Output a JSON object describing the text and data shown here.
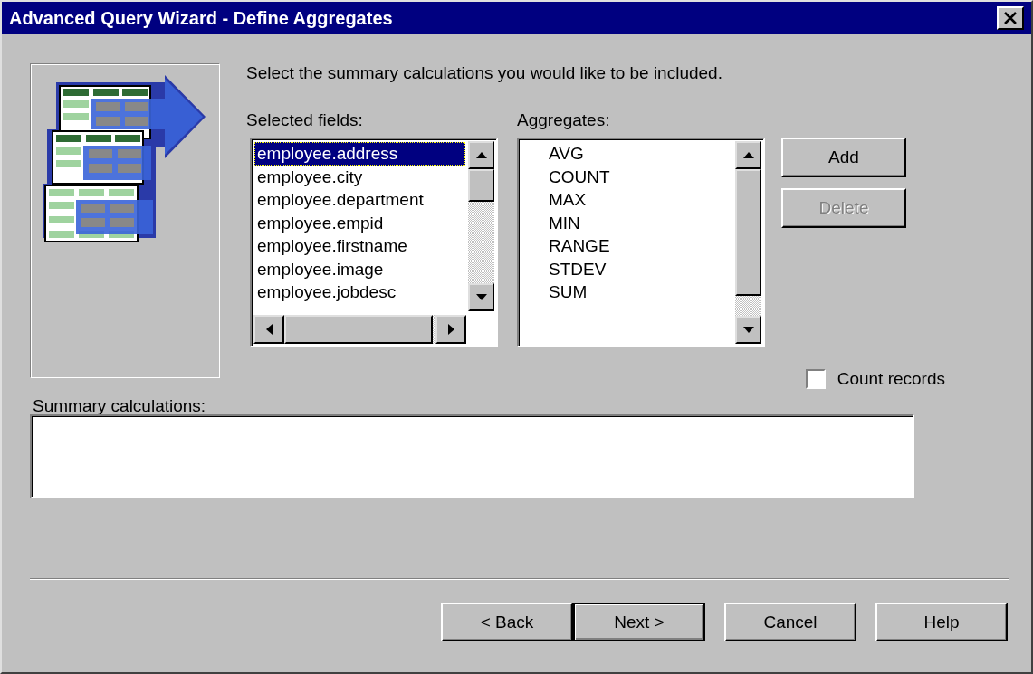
{
  "window": {
    "title": "Advanced Query Wizard - Define Aggregates"
  },
  "instruction": "Select the summary calculations you would like to be included.",
  "selected_fields": {
    "label": "Selected fields:",
    "items": [
      {
        "text": "employee.address",
        "selected": true
      },
      {
        "text": "employee.city",
        "selected": false
      },
      {
        "text": "employee.department",
        "selected": false
      },
      {
        "text": "employee.empid",
        "selected": false
      },
      {
        "text": "employee.firstname",
        "selected": false
      },
      {
        "text": "employee.image",
        "selected": false
      },
      {
        "text": "employee.jobdesc",
        "selected": false
      }
    ]
  },
  "aggregates": {
    "label": "Aggregates:",
    "items": [
      {
        "text": "AVG",
        "selected": false
      },
      {
        "text": "COUNT",
        "selected": false
      },
      {
        "text": "MAX",
        "selected": false
      },
      {
        "text": "MIN",
        "selected": false
      },
      {
        "text": "RANGE",
        "selected": false
      },
      {
        "text": "STDEV",
        "selected": false
      },
      {
        "text": "SUM",
        "selected": false
      }
    ]
  },
  "side_buttons": [
    {
      "label": "Add",
      "disabled": false
    },
    {
      "label": "Delete",
      "disabled": true
    }
  ],
  "count_records": {
    "label": "Count records",
    "checked": false
  },
  "summary": {
    "label": "Summary calculations:"
  },
  "buttons": [
    {
      "label": "< Back",
      "default": false
    },
    {
      "label": "Next >",
      "default": true
    },
    {
      "label": "Cancel",
      "default": false
    },
    {
      "label": "Help",
      "default": false
    }
  ]
}
